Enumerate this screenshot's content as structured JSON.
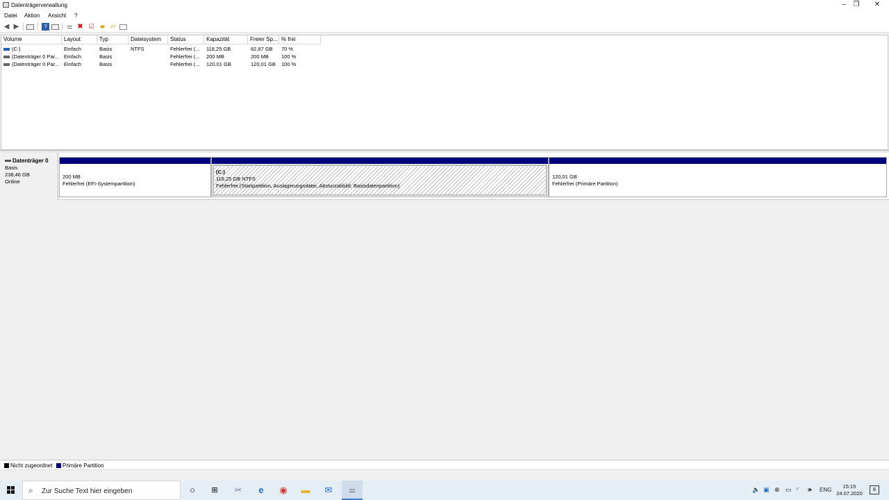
{
  "window": {
    "title": "Datenträgerverwaltung",
    "minimize": "–",
    "maximize": "❐",
    "close": "✕"
  },
  "menu": [
    "Datei",
    "Aktion",
    "Ansicht",
    "?"
  ],
  "list": {
    "columns": [
      "Volume",
      "Layout",
      "Typ",
      "Dateisystem",
      "Status",
      "Kapazität",
      "Freier Sp...",
      "% frei"
    ],
    "rows": [
      [
        "(C:)",
        "Einfach",
        "Basis",
        "NTFS",
        "Fehlerfrei (...",
        "118,25 GB",
        "82,87 GB",
        "70 %"
      ],
      [
        "(Datenträger 0 Par...",
        "Einfach",
        "Basis",
        "",
        "Fehlerfrei (...",
        "200 MB",
        "200 MB",
        "100 %"
      ],
      [
        "(Datenträger 0 Par...",
        "Einfach",
        "Basis",
        "",
        "Fehlerfrei (...",
        "120,01 GB",
        "120,01 GB",
        "100 %"
      ]
    ]
  },
  "disk": {
    "name": "Datenträger 0",
    "type": "Basis",
    "size": "238,46 GB",
    "state": "Online",
    "partitions": [
      {
        "name": "",
        "size": "200 MB",
        "status": "Fehlerfrei (EFI-Systempartition)"
      },
      {
        "name": "(C:)",
        "size": "118,25 GB NTFS",
        "status": "Fehlerfrei (Startpartition, Auslagerungsdatei, Absturzabbild, Basisdatenpartition)"
      },
      {
        "name": "",
        "size": "120,01 GB",
        "status": "Fehlerfrei (Primäre Partition)"
      }
    ]
  },
  "legend": [
    {
      "label": "Nicht zugeordnet",
      "color": "#000000"
    },
    {
      "label": "Primäre Partition",
      "color": "#00007b"
    }
  ],
  "taskbar": {
    "search_placeholder": "Zur Suche Text hier eingeben",
    "lang": "ENG",
    "time": "15:15",
    "date": "24.07.2020",
    "notifications": "8"
  },
  "colors": {
    "primary_partition": "#00007b",
    "accent": "#3d7cc9"
  }
}
